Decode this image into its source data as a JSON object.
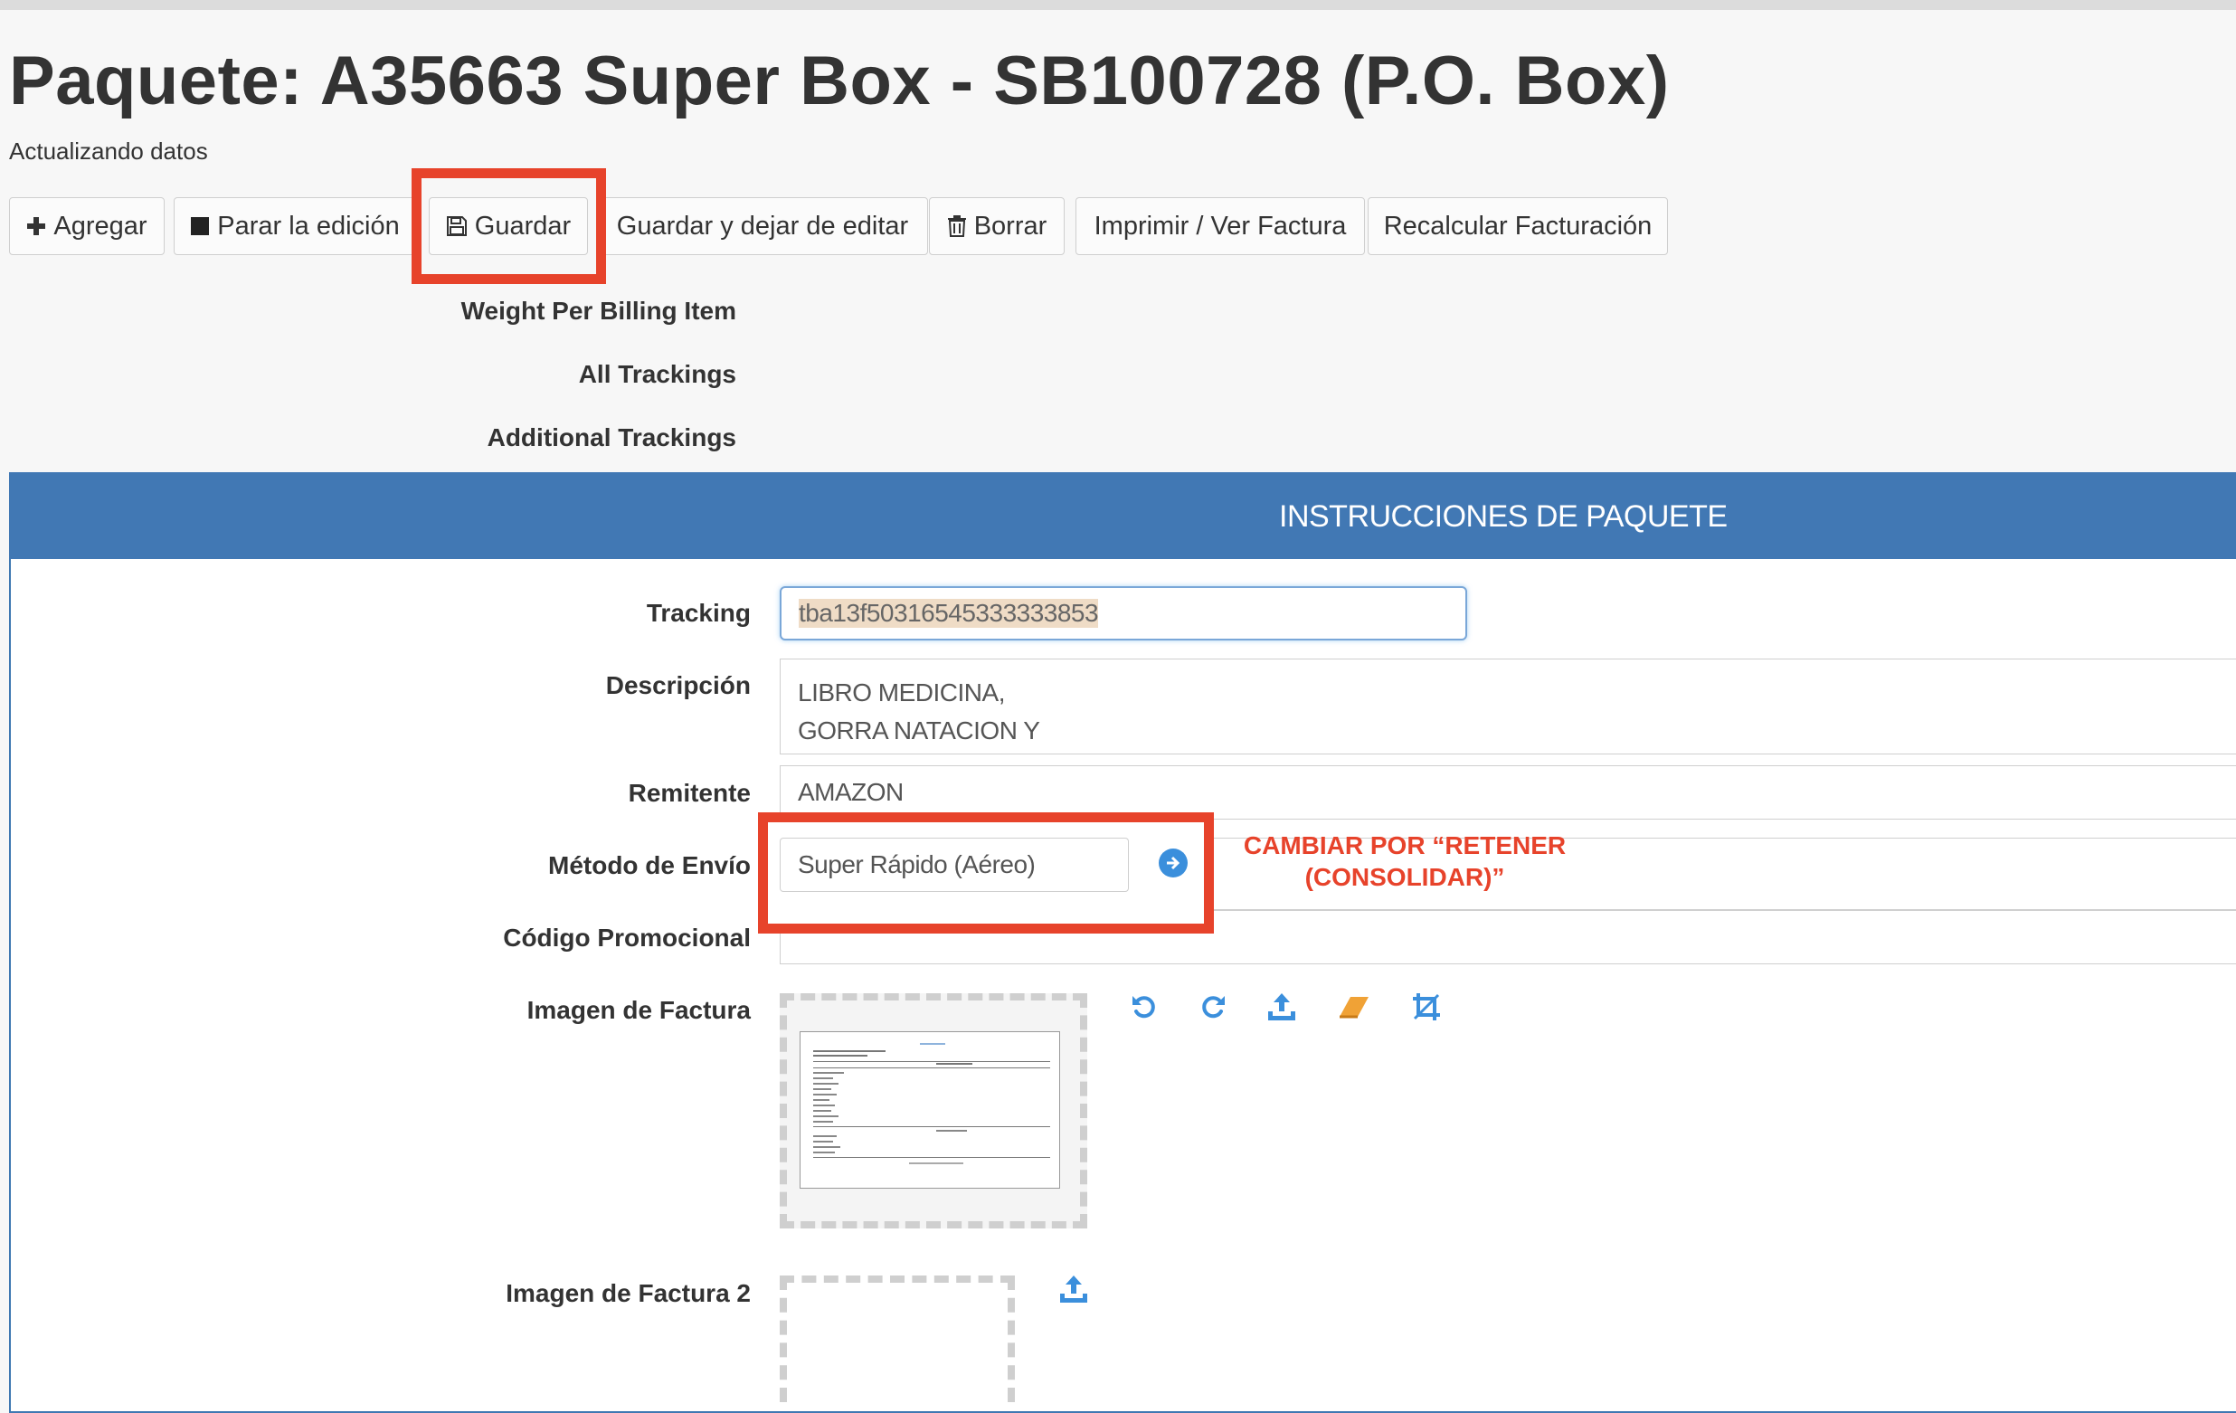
{
  "page": {
    "title": "Paquete: A35663 Super Box - SB100728 (P.O. Box)",
    "subtitle": "Actualizando datos"
  },
  "toolbar": {
    "add": "Agregar",
    "stop_edit": "Parar la edición",
    "save": "Guardar",
    "save_and_stop": "Guardar y dejar de editar",
    "delete": "Borrar",
    "print": "Imprimir / Ver Factura",
    "recalculate": "Recalcular Facturación"
  },
  "meta": {
    "weight_per_billing_item": "Weight Per Billing Item",
    "all_trackings": "All Trackings",
    "additional_trackings": "Additional Trackings"
  },
  "panel": {
    "title": "INSTRUCCIONES DE PAQUETE"
  },
  "form": {
    "tracking": {
      "label": "Tracking",
      "value": "tba13f50316545333333853"
    },
    "descripcion": {
      "label": "Descripción",
      "line1": "LIBRO MEDICINA,",
      "line2": "GORRA NATACION Y"
    },
    "remitente": {
      "label": "Remitente",
      "value": "AMAZON"
    },
    "metodo_envio": {
      "label": "Método de Envío",
      "value": "Super Rápido (Aéreo)"
    },
    "codigo_promocional": {
      "label": "Código Promocional",
      "value": ""
    },
    "imagen_factura": {
      "label": "Imagen de Factura"
    },
    "imagen_factura_2": {
      "label": "Imagen de Factura 2"
    }
  },
  "annotation": {
    "line1": "CAMBIAR POR “RETENER",
    "line2": "(CONSOLIDAR)”"
  },
  "colors": {
    "panel_header": "#4178b4",
    "highlight": "#e7432b",
    "icon_blue": "#3b8fdc",
    "eraser_orange": "#f0a236"
  }
}
